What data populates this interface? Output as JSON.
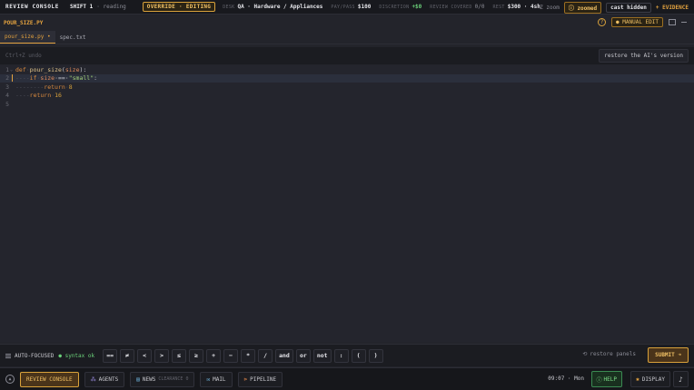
{
  "topbar": {
    "brand": "REVIEW CONSOLE",
    "shift": "SHIFT 1",
    "status": "· reading",
    "override": "OVERRIDE · EDITING",
    "desk_label": "DESK",
    "desk_value": "QA · Hardware / Appliances",
    "pay_label": "PAY/PASS",
    "pay_value": "$100",
    "discretion_label": "DISCRETION",
    "discretion_value": "+$0",
    "review_label": "REVIEW COVERED",
    "review_value": "0/0",
    "rest_label": "REST",
    "rest_value": "$300 · 4sh",
    "zoom_key": "Z zoom",
    "zoomed": "ⓘ zoomed",
    "cast_hidden": "cast hidden",
    "evidence": "+ EVIDENCE"
  },
  "file": {
    "name": "POUR_SIZE.PY",
    "help": "?",
    "manual_edit": "● MANUAL EDIT"
  },
  "tabs": [
    {
      "label": "pour_size.py •"
    },
    {
      "label": "spec.txt"
    }
  ],
  "toolbar": {
    "undo_hint": "Ctrl+Z undo",
    "restore_label": "restore the AI's version"
  },
  "editor": {
    "lines": [
      {
        "num": "1",
        "fold": "⌄"
      },
      {
        "num": "2"
      },
      {
        "num": "3"
      },
      {
        "num": "4"
      },
      {
        "num": "5"
      }
    ],
    "tokens": {
      "l1_def": "def",
      "l1_fn": "pour_size",
      "l1_open": "(",
      "l1_param": "size",
      "l1_close": "):",
      "l2_ws": "----",
      "l2_if": "if",
      "l2_sp1": "·",
      "l2_var": "size",
      "l2_op": "·==·",
      "l2_str": "\"small\"",
      "l2_colon": ":",
      "l3_ws": "--------",
      "l3_ret": "return",
      "l3_sp": "·",
      "l3_num": "8",
      "l4_ws": "----",
      "l4_ret": "return",
      "l4_sp": "·",
      "l4_num": "16"
    }
  },
  "symbar": {
    "autofocused": "AUTO-FOCUSED",
    "syntax": "● syntax ok",
    "keys": [
      "==",
      "≠",
      "<",
      ">",
      "≤",
      "≥",
      "+",
      "−",
      "*",
      "/",
      "and",
      "or",
      "not",
      ":",
      "(",
      ")"
    ],
    "restore_panels": "restore panels",
    "submit": "SUBMIT ➜"
  },
  "nav": {
    "review_console": "REVIEW CONSOLE",
    "agents": "AGENTS",
    "news": "NEWS",
    "news_sub": "CLEARANCE 0",
    "mail": "MAIL",
    "pipeline": "PIPELINE",
    "clock": "09:07 · Mon",
    "help": "HELP",
    "display": "DISPLAY",
    "music": "♪"
  }
}
